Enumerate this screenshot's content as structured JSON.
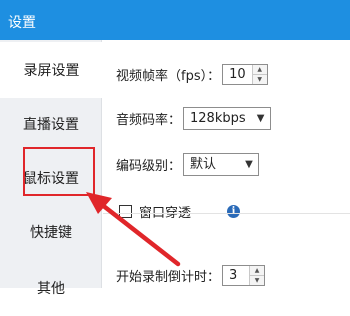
{
  "window": {
    "title": "设置"
  },
  "sidebar": {
    "items": [
      {
        "label": "录屏设置"
      },
      {
        "label": "直播设置"
      },
      {
        "label": "鼠标设置"
      },
      {
        "label": "快捷键"
      },
      {
        "label": "其他"
      }
    ]
  },
  "settings": {
    "fps": {
      "label": "视频帧率（fps）：",
      "value": "10"
    },
    "audio_bitrate": {
      "label": "音频码率：",
      "value": "128kbps"
    },
    "encode_level": {
      "label": "编码级别：",
      "value": "默认"
    },
    "window_through": {
      "label": "窗口穿透",
      "checked": false
    },
    "countdown": {
      "label": "开始录制倒计时：",
      "value": "3"
    }
  },
  "annotation": {
    "highlight_color": "#e0262a"
  },
  "colors": {
    "titlebar": "#1e8fe1",
    "sidebar_bg": "#eef0f3",
    "info_icon": "#2a6ab8"
  },
  "icons": {
    "info": "info-icon",
    "spin_up": "caret-up-icon",
    "spin_down": "caret-down-icon",
    "dropdown": "caret-down-icon"
  }
}
